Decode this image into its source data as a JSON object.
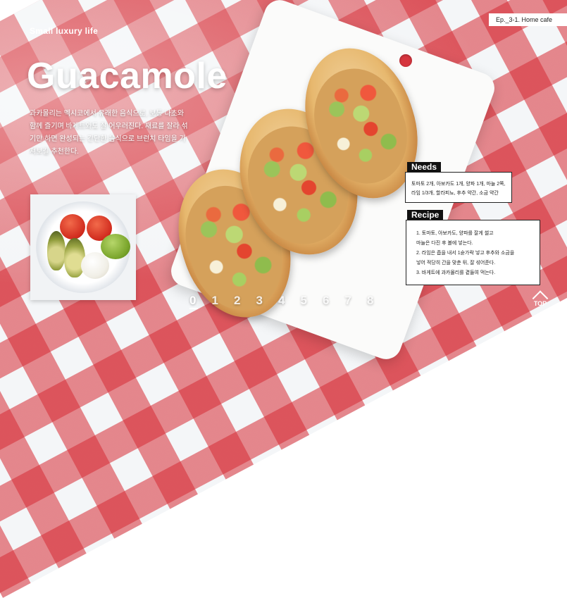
{
  "header": {
    "brand": "Small luxury life",
    "episode": "Ep._3-1.  Home cafe"
  },
  "hero": {
    "title": "Guacamole",
    "description": "과카몰리는 멕시코에서 유래한 음식으로, 보통 나초와 함께 즐기며 바게트와도 잘 어우러진다. 재료를 잘라 섞기만 하면 완성되는 간단한 음식으로 브런치 타임을 가져보길 추천한다."
  },
  "needs": {
    "label": "Needs",
    "lines": [
      "토마토 2개, 아보카도 1개, 양파 1개, 마늘 2쪽,",
      "라임 1/3개, 할라피뇨, 후추 약간, 소금 약간"
    ]
  },
  "recipe": {
    "label": "Recipe",
    "lines": [
      "1. 토마토, 아보카도, 양파를 잘게 썰고",
      "    마늘은 다진 후 볼에 넣는다.",
      "2. 라임은 즙을 내서 1숟가락 넣고 후추와 소금을",
      "    넣어 적당히 간을 맞춘 뒤, 잘 섞어준다.",
      "3. 바게트에 과카몰리를 곁들여 먹는다."
    ]
  },
  "pager": {
    "pages": [
      "0",
      "1",
      "2",
      "3",
      "4",
      "5",
      "6",
      "7",
      "8"
    ],
    "active": "0"
  },
  "top_button": {
    "label": "TOP"
  },
  "colors": {
    "tablecloth_red": "#d62b34",
    "panel_label_bg": "#111111",
    "text_light": "#ffffff"
  }
}
